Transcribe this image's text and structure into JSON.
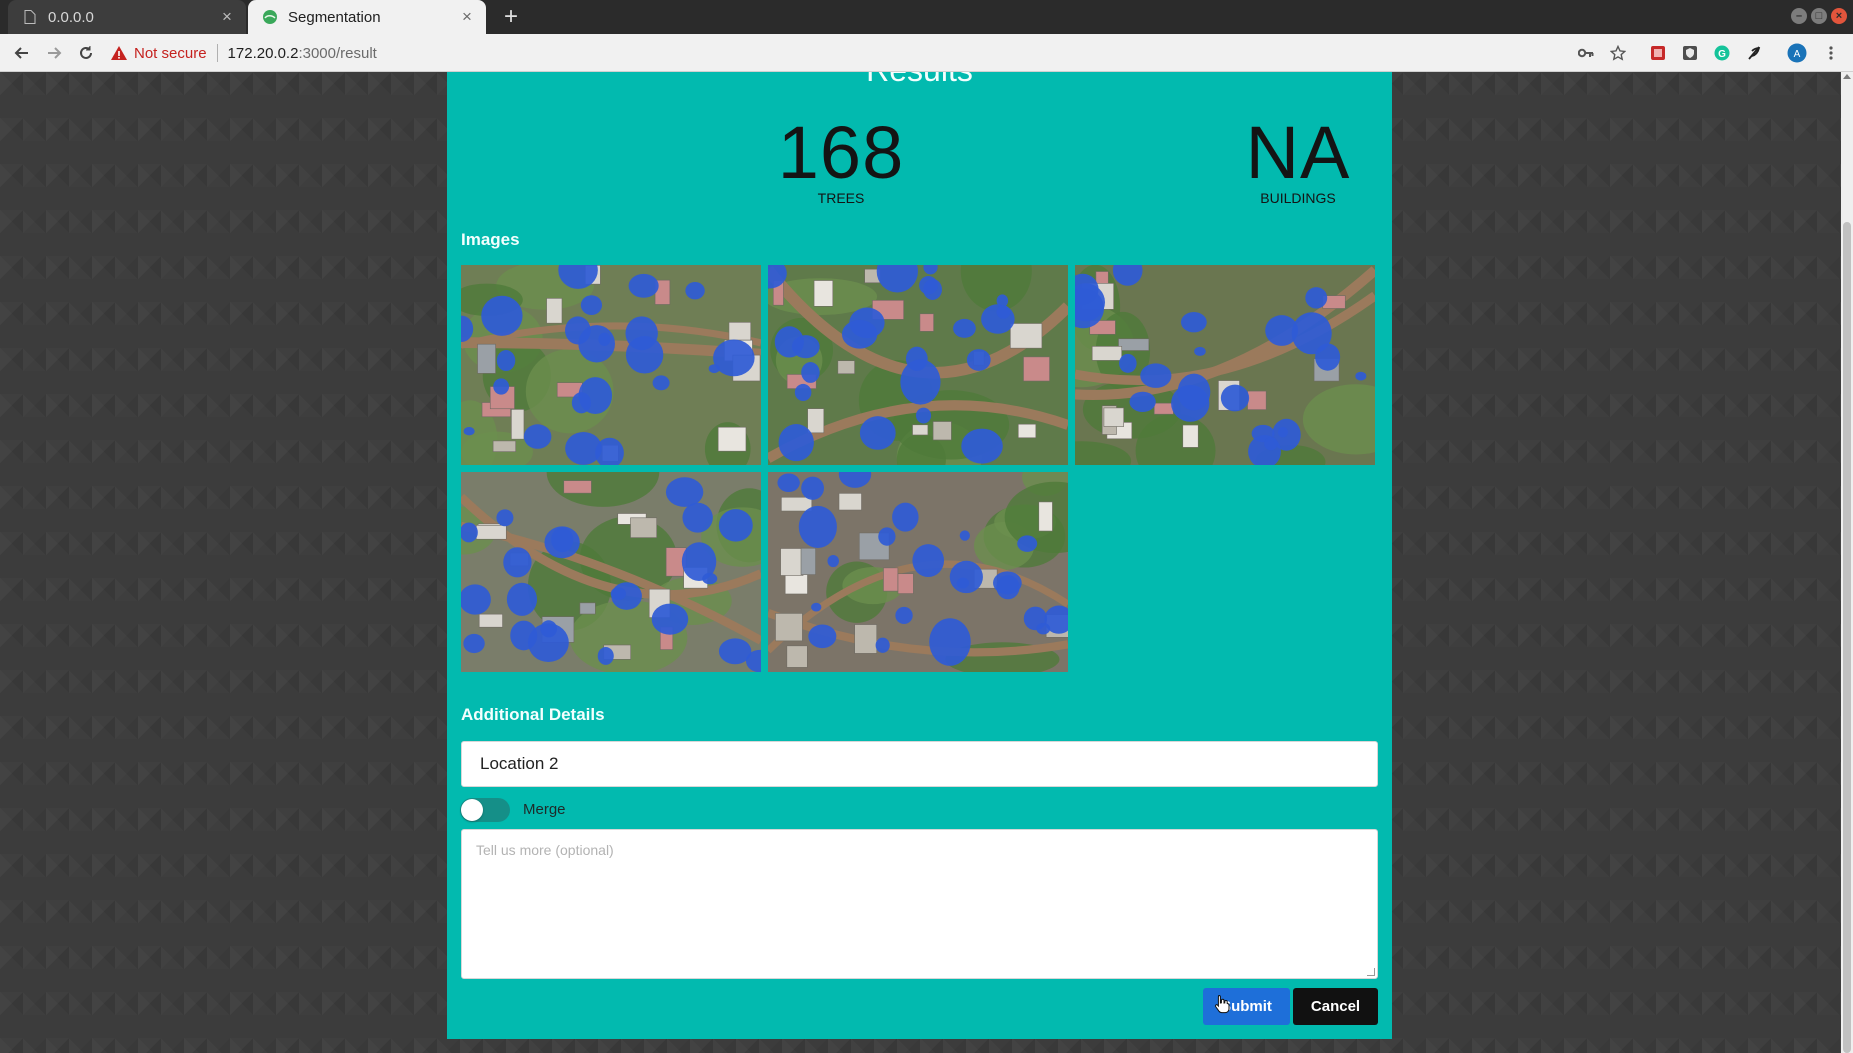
{
  "browser": {
    "tabs": [
      {
        "title": "0.0.0.0",
        "active": false
      },
      {
        "title": "Segmentation",
        "active": true
      }
    ],
    "address": {
      "security_label": "Not secure",
      "host": "172.20.0.2",
      "path": ":3000/result"
    }
  },
  "page": {
    "title": "Results",
    "stats": [
      {
        "value": "168",
        "label": "TREES"
      },
      {
        "value": "NA",
        "label": "BUILDINGS"
      }
    ],
    "images_heading": "Images",
    "images": [
      {
        "name": "segmented-image-1"
      },
      {
        "name": "segmented-image-2"
      },
      {
        "name": "segmented-image-3"
      },
      {
        "name": "segmented-image-4"
      },
      {
        "name": "segmented-image-5"
      }
    ],
    "details_heading": "Additional Details",
    "location_value": "Location 2",
    "merge_label": "Merge",
    "merge_on": false,
    "notes_placeholder": "Tell us more (optional)",
    "submit_label": "Submit",
    "cancel_label": "Cancel"
  },
  "colors": {
    "card": "#02baaf",
    "overlay": "#2f5bd6",
    "submit": "#1e6fd9",
    "cancel": "#111111"
  }
}
